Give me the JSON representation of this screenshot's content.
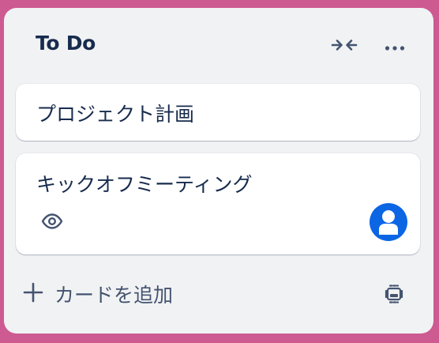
{
  "list": {
    "title": "To Do",
    "collapse_icon": "collapse-arrows-icon",
    "more_icon": "more-horizontal-icon"
  },
  "cards": [
    {
      "title": "プロジェクト計画"
    },
    {
      "title": "キックオフミーティング",
      "badges": [
        "watch-eye-icon"
      ],
      "member_icon": "user-avatar-icon"
    }
  ],
  "footer": {
    "add_card_label": "カードを追加",
    "add_icon": "plus-icon",
    "template_icon": "card-template-icon"
  },
  "colors": {
    "board_background": "#cd5a91",
    "list_background": "#f1f2f4",
    "card_background": "#ffffff",
    "text_primary": "#172b4d",
    "text_subtle": "#44546f",
    "avatar_background": "#0c66e4"
  }
}
